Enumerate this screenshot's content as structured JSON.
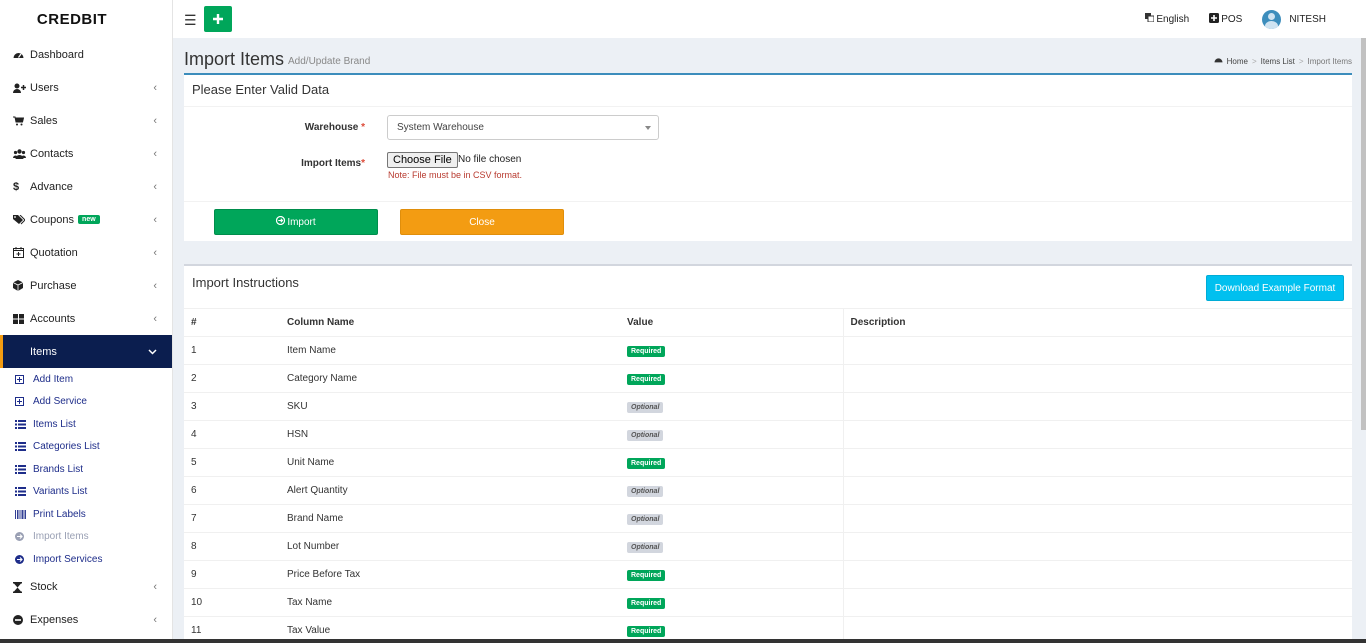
{
  "brand": "CREDBIT",
  "topbar": {
    "language": "English",
    "pos": "POS",
    "user": "NITESH"
  },
  "sidebar": {
    "items": [
      {
        "label": "Dashboard",
        "icon": "dashboard-icon",
        "chevron": false
      },
      {
        "label": "Users",
        "icon": "user-plus-icon",
        "chevron": true
      },
      {
        "label": "Sales",
        "icon": "cart-icon",
        "chevron": true
      },
      {
        "label": "Contacts",
        "icon": "users-icon",
        "chevron": true
      },
      {
        "label": "Advance",
        "icon": "dollar-icon",
        "chevron": true
      },
      {
        "label": "Coupons",
        "icon": "tags-icon",
        "chevron": true,
        "badge": "new"
      },
      {
        "label": "Quotation",
        "icon": "calendar-plus-icon",
        "chevron": true
      },
      {
        "label": "Purchase",
        "icon": "cube-icon",
        "chevron": true
      },
      {
        "label": "Accounts",
        "icon": "grid-icon",
        "chevron": true
      },
      {
        "label": "Items",
        "icon": "",
        "chevron": true,
        "active": true
      }
    ],
    "subitems": [
      {
        "label": "Add Item",
        "icon": "plus-square-icon"
      },
      {
        "label": "Add Service",
        "icon": "plus-square-icon"
      },
      {
        "label": "Items List",
        "icon": "list-icon"
      },
      {
        "label": "Categories List",
        "icon": "list-icon"
      },
      {
        "label": "Brands List",
        "icon": "list-icon"
      },
      {
        "label": "Variants List",
        "icon": "list-icon"
      },
      {
        "label": "Print Labels",
        "icon": "barcode-icon"
      },
      {
        "label": "Import Items",
        "icon": "arrow-circle-icon",
        "disabled": true
      },
      {
        "label": "Import Services",
        "icon": "arrow-circle-icon"
      }
    ],
    "after": [
      {
        "label": "Stock",
        "icon": "hourglass-icon",
        "chevron": true
      },
      {
        "label": "Expenses",
        "icon": "minus-circle-icon",
        "chevron": true
      }
    ]
  },
  "page": {
    "title": "Import Items",
    "subtitle": "Add/Update Brand",
    "breadcrumb": [
      "Home",
      "Items List",
      "Import Items"
    ]
  },
  "form": {
    "box_title": "Please Enter Valid Data",
    "warehouse_label": "Warehouse",
    "warehouse_value": "System Warehouse",
    "import_label": "Import Items",
    "choose_file": "Choose File",
    "no_file": "No file chosen",
    "note": "Note: File must be in CSV format.",
    "import_btn": "Import",
    "close_btn": "Close"
  },
  "instructions": {
    "title": "Import Instructions",
    "download_btn": "Download Example Format",
    "headers": [
      "#",
      "Column Name",
      "Value",
      "Description"
    ],
    "rows": [
      {
        "n": "1",
        "name": "Item Name",
        "value": "Required"
      },
      {
        "n": "2",
        "name": "Category Name",
        "value": "Required"
      },
      {
        "n": "3",
        "name": "SKU",
        "value": "Optional"
      },
      {
        "n": "4",
        "name": "HSN",
        "value": "Optional"
      },
      {
        "n": "5",
        "name": "Unit Name",
        "value": "Required"
      },
      {
        "n": "6",
        "name": "Alert Quantity",
        "value": "Optional"
      },
      {
        "n": "7",
        "name": "Brand Name",
        "value": "Optional"
      },
      {
        "n": "8",
        "name": "Lot Number",
        "value": "Optional"
      },
      {
        "n": "9",
        "name": "Price Before Tax",
        "value": "Required"
      },
      {
        "n": "10",
        "name": "Tax Name",
        "value": "Required"
      },
      {
        "n": "11",
        "name": "Tax Value",
        "value": "Required"
      }
    ]
  },
  "colors": {
    "green": "#00a65a",
    "orange": "#f39c12",
    "cyan": "#00c0ef",
    "navy": "#0b1e4f"
  }
}
